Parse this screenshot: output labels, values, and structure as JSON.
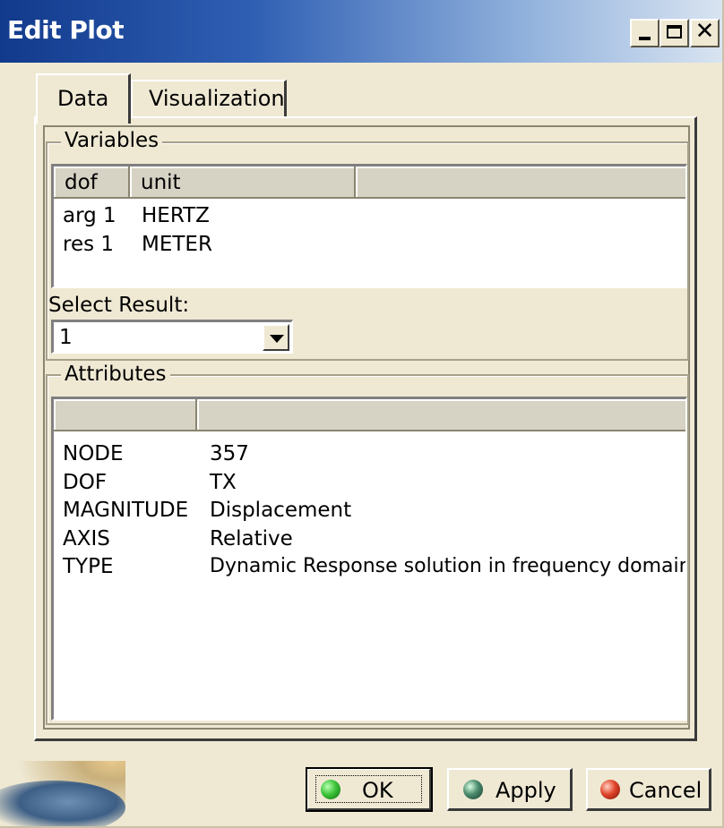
{
  "window": {
    "title": "Edit Plot"
  },
  "tabs": [
    {
      "label": "Data",
      "active": true
    },
    {
      "label": "Visualization",
      "active": false
    }
  ],
  "variables": {
    "group_label": "Variables",
    "columns": [
      "dof",
      "unit",
      ""
    ],
    "rows": [
      {
        "dof": "arg 1",
        "unit": "HERTZ"
      },
      {
        "dof": "res 1",
        "unit": "METER"
      }
    ]
  },
  "select_result": {
    "label": "Select Result:",
    "value": "1"
  },
  "attributes": {
    "group_label": "Attributes",
    "columns": [
      "",
      ""
    ],
    "rows": [
      {
        "name": "NODE",
        "value": "357"
      },
      {
        "name": "DOF",
        "value": "TX"
      },
      {
        "name": "MAGNITUDE",
        "value": "Displacement"
      },
      {
        "name": "AXIS",
        "value": "Relative"
      },
      {
        "name": "TYPE",
        "value": "Dynamic Response solution in frequency domain"
      }
    ]
  },
  "buttons": {
    "ok": "OK",
    "apply": "Apply",
    "cancel": "Cancel"
  },
  "icons": {
    "ok": "green-sphere-icon",
    "apply": "dark-green-sphere-icon",
    "cancel": "red-sphere-icon"
  },
  "colors": {
    "title_bar_start": "#123a8c",
    "dialog_bg": "#efe9d4"
  }
}
